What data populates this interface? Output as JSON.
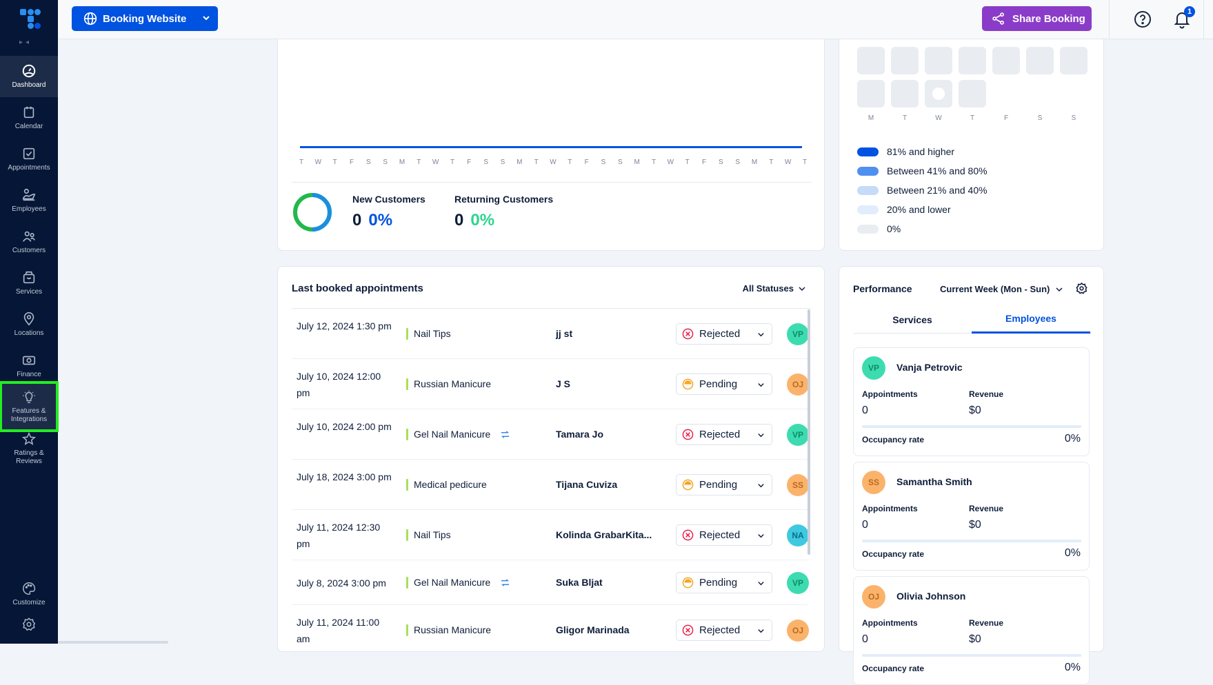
{
  "sidebar": {
    "items": [
      {
        "label": "Dashboard",
        "icon": "dashboard-icon",
        "active": true
      },
      {
        "label": "Calendar",
        "icon": "calendar-icon"
      },
      {
        "label": "Appointments",
        "icon": "appointments-icon"
      },
      {
        "label": "Employees",
        "icon": "employees-icon"
      },
      {
        "label": "Customers",
        "icon": "customers-icon"
      },
      {
        "label": "Services",
        "icon": "services-icon"
      },
      {
        "label": "Locations",
        "icon": "location-pin-icon"
      },
      {
        "label": "Finance",
        "icon": "finance-icon"
      },
      {
        "label": "Features &",
        "label2": "Integrations",
        "icon": "lightbulb-icon",
        "highlighted": true
      },
      {
        "label": "Ratings &",
        "label2": "Reviews",
        "icon": "star-icon"
      }
    ],
    "bottom": [
      {
        "label": "Customize",
        "icon": "palette-icon"
      },
      {
        "label": "",
        "icon": "settings-gear-icon"
      }
    ]
  },
  "topbar": {
    "booking_label": "Booking Website",
    "share_label": "Share Booking",
    "notification_count": "1"
  },
  "colors": {
    "primary": "#0052e0",
    "share": "#8a3cc8",
    "sidebar_bg": "#051636",
    "highlight": "#22ee22",
    "rejected": "#e8224a",
    "pending": "#f5a623",
    "service_bar": "#a9e05a"
  },
  "chart": {
    "day_labels": [
      "T",
      "W",
      "T",
      "F",
      "S",
      "S",
      "M",
      "T",
      "W",
      "T",
      "F",
      "S",
      "S",
      "M",
      "T",
      "W",
      "T",
      "F",
      "S",
      "S",
      "M",
      "T",
      "W",
      "T",
      "F",
      "S",
      "S",
      "M",
      "T",
      "W",
      "T"
    ]
  },
  "chart_data": {
    "type": "line",
    "title": "",
    "x": [
      "T",
      "W",
      "T",
      "F",
      "S",
      "S",
      "M",
      "T",
      "W",
      "T",
      "F",
      "S",
      "S",
      "M",
      "T",
      "W",
      "T",
      "F",
      "S",
      "S",
      "M",
      "T",
      "W",
      "T",
      "F",
      "S",
      "S",
      "M",
      "T",
      "W",
      "T"
    ],
    "series": [
      {
        "name": "Appointments",
        "values": [
          0,
          0,
          0,
          0,
          0,
          0,
          0,
          0,
          0,
          0,
          0,
          0,
          0,
          0,
          0,
          0,
          0,
          0,
          0,
          0,
          0,
          0,
          0,
          0,
          0,
          0,
          0,
          0,
          0,
          0,
          0
        ]
      }
    ],
    "xlabel": "",
    "ylabel": "",
    "grid": false
  },
  "customers": {
    "new_label": "New Customers",
    "new_count": "0",
    "new_pct": "0%",
    "returning_label": "Returning Customers",
    "returning_count": "0",
    "returning_pct": "0%"
  },
  "heatmap": {
    "day_labels": [
      "M",
      "T",
      "W",
      "T",
      "F",
      "S",
      "S"
    ],
    "legend": [
      {
        "label": "81% and higher",
        "color": "#0052e0"
      },
      {
        "label": "Between 41% and 80%",
        "color": "#4f8fef"
      },
      {
        "label": "Between 21% and 40%",
        "color": "#c5dbf8"
      },
      {
        "label": "20% and lower",
        "color": "#e1edfc"
      },
      {
        "label": "0%",
        "color": "#e9ecf1"
      }
    ]
  },
  "appointments": {
    "title": "Last booked appointments",
    "filter_label": "All Statuses",
    "rows": [
      {
        "date": "July 12, 2024 1:30 pm",
        "service": "Nail Tips",
        "recurring": false,
        "customer": "jj st",
        "status": "Rejected",
        "employee": "VP",
        "avatar_color": "#3ddcb0"
      },
      {
        "date": "July 10, 2024 12:00 pm",
        "service": "Russian Manicure",
        "recurring": false,
        "customer": "J S",
        "status": "Pending",
        "employee": "OJ",
        "avatar_color": "#fbb36b"
      },
      {
        "date": "July 10, 2024 2:00 pm",
        "service": "Gel Nail Manicure",
        "recurring": true,
        "customer": "Tamara Jo",
        "status": "Rejected",
        "employee": "VP",
        "avatar_color": "#3ddcb0"
      },
      {
        "date": "July 18, 2024 3:00 pm",
        "service": "Medical pedicure",
        "recurring": false,
        "customer": "Tijana Cuviza",
        "status": "Pending",
        "employee": "SS",
        "avatar_color": "#fbb36b"
      },
      {
        "date": "July 11, 2024 12:30 pm",
        "service": "Nail Tips",
        "recurring": false,
        "customer": "Kolinda GrabarKita...",
        "status": "Rejected",
        "employee": "NA",
        "avatar_color": "#3ec9e0"
      },
      {
        "date": "July 8, 2024 3:00 pm",
        "service": "Gel Nail Manicure",
        "recurring": true,
        "customer": "Suka Bljat",
        "status": "Pending",
        "employee": "VP",
        "avatar_color": "#3ddcb0"
      },
      {
        "date": "July 11, 2024 11:00 am",
        "service": "Russian Manicure",
        "recurring": false,
        "customer": "Gligor Marinada",
        "status": "Rejected",
        "employee": "OJ",
        "avatar_color": "#fbb36b"
      }
    ]
  },
  "performance": {
    "title": "Performance",
    "period": "Current Week (Mon - Sun)",
    "tabs": [
      "Services",
      "Employees"
    ],
    "active_tab": "Employees",
    "labels": {
      "appointments": "Appointments",
      "revenue": "Revenue",
      "occupancy": "Occupancy rate"
    },
    "employees": [
      {
        "initials": "VP",
        "name": "Vanja Petrovic",
        "appointments": "0",
        "revenue": "$0",
        "occupancy": "0%",
        "occupancy_value": 0,
        "color": "#3ddcb0"
      },
      {
        "initials": "SS",
        "name": "Samantha Smith",
        "appointments": "0",
        "revenue": "$0",
        "occupancy": "0%",
        "occupancy_value": 0,
        "color": "#fbb36b"
      },
      {
        "initials": "OJ",
        "name": "Olivia Johnson",
        "appointments": "0",
        "revenue": "$0",
        "occupancy": "0%",
        "occupancy_value": 0,
        "color": "#fbb36b"
      }
    ]
  }
}
